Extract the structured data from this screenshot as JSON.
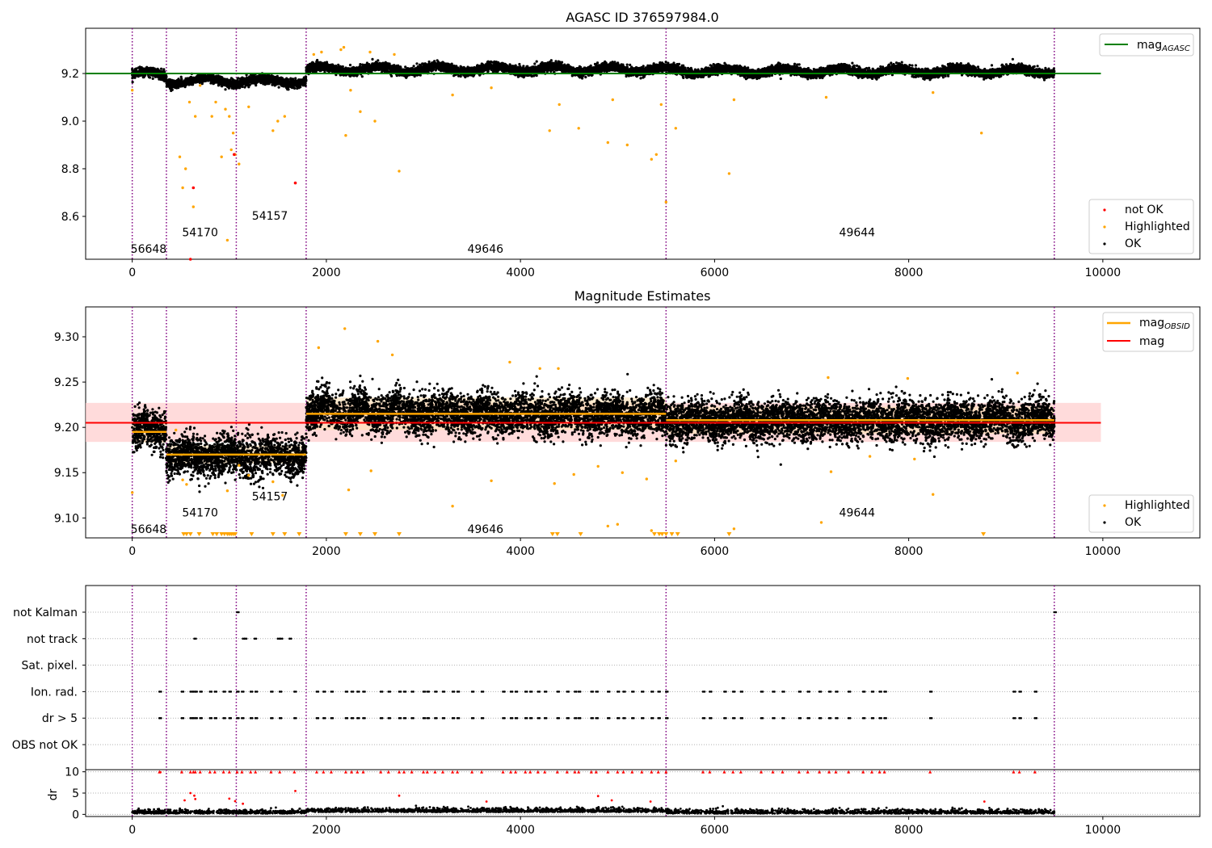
{
  "figure": {
    "title_top": "AGASC ID 376597984.0",
    "title_middle": "Magnitude Estimates"
  },
  "colors": {
    "ok": "#000000",
    "highlighted": "#ffa500",
    "not_ok": "#ff0000",
    "agasc_line": "#008000",
    "mag_line": "#ff0000",
    "obsid_line": "#ffa500",
    "obs_boundary": "#800080",
    "band_mag": "#ffcccc",
    "band_obsid": "#ffe0b0"
  },
  "legends": {
    "top_line": {
      "text": "mag",
      "sub": "AGASC"
    },
    "top_points": [
      "not OK",
      "Highlighted",
      "OK"
    ],
    "middle_lines": [
      {
        "text": "mag",
        "sub": "OBSID"
      },
      {
        "text": "mag",
        "sub": ""
      }
    ],
    "middle_points": [
      "Highlighted",
      "OK"
    ]
  },
  "chart_data": [
    {
      "type": "scatter",
      "title": "AGASC ID 376597984.0",
      "xlim": [
        -480,
        11000
      ],
      "ylim": [
        8.42,
        9.39
      ],
      "xticks": [
        0,
        2000,
        4000,
        6000,
        8000,
        10000
      ],
      "yticks": [
        8.6,
        8.8,
        9.0,
        9.2
      ],
      "agasc_mag": 9.2,
      "agasc_line_x": [
        -480,
        9980
      ],
      "legend": [
        "mag_AGASC",
        "not OK",
        "Highlighted",
        "OK"
      ],
      "observation_boundaries": [
        0,
        352,
        1072,
        1792,
        5500,
        9500
      ],
      "obsids": [
        {
          "label": "56648",
          "x": 0,
          "y": 8.46
        },
        {
          "label": "54170",
          "x": 530,
          "y": 8.53
        },
        {
          "label": "54157",
          "x": 1250,
          "y": 8.6
        },
        {
          "label": "49646",
          "x": 3470,
          "y": 8.46
        },
        {
          "label": "49644",
          "x": 7300,
          "y": 8.53
        }
      ],
      "segments": [
        {
          "x": [
            0,
            352
          ],
          "mean": 9.195,
          "std": 0.012
        },
        {
          "x": [
            352,
            1792
          ],
          "mean": 9.17,
          "std": 0.01
        },
        {
          "x": [
            1792,
            5500
          ],
          "mean": 9.215,
          "std": 0.018
        },
        {
          "x": [
            5500,
            9500
          ],
          "mean": 9.208,
          "std": 0.015
        }
      ],
      "highlighted_points": [
        [
          0,
          9.13
        ],
        [
          490,
          8.85
        ],
        [
          520,
          8.72
        ],
        [
          550,
          8.8
        ],
        [
          590,
          9.08
        ],
        [
          630,
          8.64
        ],
        [
          650,
          9.02
        ],
        [
          700,
          9.15
        ],
        [
          820,
          9.02
        ],
        [
          860,
          9.08
        ],
        [
          920,
          8.85
        ],
        [
          960,
          9.05
        ],
        [
          980,
          8.5
        ],
        [
          1000,
          9.02
        ],
        [
          1020,
          8.88
        ],
        [
          1040,
          8.95
        ],
        [
          1060,
          8.86
        ],
        [
          1100,
          8.82
        ],
        [
          1200,
          9.06
        ],
        [
          1450,
          8.96
        ],
        [
          1500,
          9.0
        ],
        [
          1570,
          9.02
        ],
        [
          2200,
          8.94
        ],
        [
          2250,
          9.13
        ],
        [
          2350,
          9.04
        ],
        [
          2500,
          9.0
        ],
        [
          2750,
          8.79
        ],
        [
          3300,
          9.11
        ],
        [
          3700,
          9.14
        ],
        [
          4300,
          8.96
        ],
        [
          4400,
          9.07
        ],
        [
          4600,
          8.97
        ],
        [
          4900,
          8.91
        ],
        [
          4950,
          9.09
        ],
        [
          5100,
          8.9
        ],
        [
          5350,
          8.84
        ],
        [
          5400,
          8.86
        ],
        [
          5450,
          9.07
        ],
        [
          5500,
          8.66
        ],
        [
          5600,
          8.97
        ],
        [
          6150,
          8.78
        ],
        [
          6200,
          9.09
        ],
        [
          7150,
          9.1
        ],
        [
          8250,
          9.12
        ],
        [
          8750,
          8.95
        ],
        [
          1870,
          9.28
        ],
        [
          1950,
          9.29
        ],
        [
          2150,
          9.3
        ],
        [
          2180,
          9.31
        ],
        [
          2450,
          9.29
        ],
        [
          2700,
          9.28
        ]
      ],
      "not_ok_points": [
        [
          630,
          8.72
        ],
        [
          1050,
          8.86
        ],
        [
          1680,
          8.74
        ],
        [
          600,
          8.42
        ]
      ],
      "ok_points": [
        [
          0,
          9.2
        ],
        [
          200,
          9.21
        ],
        [
          400,
          9.17
        ],
        [
          1000,
          9.17
        ],
        [
          1790,
          9.17
        ],
        [
          2000,
          9.22
        ],
        [
          4000,
          9.21
        ],
        [
          6000,
          9.2
        ],
        [
          9500,
          9.21
        ]
      ]
    },
    {
      "type": "scatter",
      "title": "Magnitude Estimates",
      "xlim": [
        -480,
        11000
      ],
      "ylim": [
        9.078,
        9.333
      ],
      "xticks": [
        0,
        2000,
        4000,
        6000,
        8000,
        10000
      ],
      "yticks": [
        9.1,
        9.15,
        9.2,
        9.25,
        9.3
      ],
      "mag": 9.205,
      "mag_band": [
        9.184,
        9.227
      ],
      "mag_line_x": [
        -480,
        9980
      ],
      "legend": [
        "mag_OBSID",
        "mag",
        "Highlighted",
        "OK"
      ],
      "obsid_mags": [
        {
          "x": [
            0,
            352
          ],
          "mag": 9.195
        },
        {
          "x": [
            352,
            1792
          ],
          "mag": 9.17
        },
        {
          "x": [
            1792,
            5500
          ],
          "mag": 9.215
        },
        {
          "x": [
            5500,
            9500
          ],
          "mag": 9.208
        }
      ],
      "obsids": [
        {
          "label": "56648",
          "x": 0,
          "y": 9.087
        },
        {
          "label": "54170",
          "x": 530,
          "y": 9.105
        },
        {
          "label": "54157",
          "x": 1250,
          "y": 9.123
        },
        {
          "label": "49646",
          "x": 3470,
          "y": 9.087
        },
        {
          "label": "49644",
          "x": 7300,
          "y": 9.105
        }
      ],
      "highlighted_points": [
        [
          0,
          9.128
        ],
        [
          450,
          9.197
        ],
        [
          520,
          9.142
        ],
        [
          560,
          9.137
        ],
        [
          980,
          9.13
        ],
        [
          1100,
          9.158
        ],
        [
          1200,
          9.147
        ],
        [
          1450,
          9.14
        ],
        [
          1550,
          9.125
        ],
        [
          2230,
          9.131
        ],
        [
          2460,
          9.152
        ],
        [
          3300,
          9.113
        ],
        [
          3700,
          9.141
        ],
        [
          4350,
          9.138
        ],
        [
          4550,
          9.148
        ],
        [
          4800,
          9.157
        ],
        [
          5050,
          9.15
        ],
        [
          5300,
          9.143
        ],
        [
          5600,
          9.163
        ],
        [
          7100,
          9.095
        ],
        [
          7200,
          9.151
        ],
        [
          7600,
          9.168
        ],
        [
          8060,
          9.165
        ],
        [
          8250,
          9.126
        ],
        [
          4900,
          9.091
        ],
        [
          5000,
          9.093
        ],
        [
          5350,
          9.086
        ],
        [
          6200,
          9.088
        ],
        [
          1920,
          9.288
        ],
        [
          2190,
          9.309
        ],
        [
          2530,
          9.295
        ],
        [
          2680,
          9.28
        ],
        [
          3890,
          9.272
        ],
        [
          4200,
          9.265
        ],
        [
          4390,
          9.265
        ],
        [
          7170,
          9.255
        ],
        [
          7990,
          9.254
        ],
        [
          9120,
          9.26
        ]
      ],
      "below_range_x": [
        530,
        560,
        600,
        690,
        830,
        870,
        920,
        950,
        980,
        1000,
        1020,
        1040,
        1060,
        1230,
        1450,
        1570,
        1720,
        2200,
        2350,
        2500,
        2750,
        4330,
        4380,
        4620,
        5380,
        5430,
        5460,
        5500,
        5560,
        5620,
        6150,
        8770
      ],
      "ok_points": [
        [
          0,
          9.2
        ],
        [
          200,
          9.2
        ],
        [
          1000,
          9.17
        ],
        [
          2000,
          9.22
        ],
        [
          4000,
          9.21
        ],
        [
          6000,
          9.21
        ],
        [
          9500,
          9.21
        ]
      ]
    },
    {
      "type": "scatter",
      "xlim": [
        -480,
        11000
      ],
      "xticks": [
        0,
        2000,
        4000,
        6000,
        8000,
        10000
      ],
      "categories": [
        "not Kalman",
        "not track",
        "Sat. pixel.",
        "Ion. rad.",
        "dr > 5",
        "OBS not OK"
      ],
      "observation_boundaries": [
        0,
        352,
        1072,
        1792,
        5500,
        9500
      ],
      "flag_points": {
        "not Kalman": [
          1080,
          9500
        ],
        "not track": [
          640,
          1140,
          1160,
          1260,
          1500,
          1530,
          1620
        ],
        "Sat. pixel.": [],
        "Ion. rad.": [
          280,
          510,
          600,
          630,
          650,
          700,
          800,
          850,
          940,
          1000,
          1080,
          1130,
          1220,
          1270,
          1430,
          1520,
          1670,
          1900,
          1970,
          2050,
          2200,
          2260,
          2320,
          2380,
          2560,
          2640,
          2750,
          2800,
          2880,
          3000,
          3040,
          3120,
          3200,
          3300,
          3350,
          3500,
          3600,
          3820,
          3900,
          3950,
          4050,
          4100,
          4180,
          4250,
          4380,
          4480,
          4560,
          4600,
          4730,
          4780,
          4900,
          5000,
          5060,
          5150,
          5250,
          5350,
          5420,
          5500,
          5880,
          5950,
          6100,
          6190,
          6270,
          6480,
          6600,
          6700,
          6870,
          6960,
          7080,
          7180,
          7250,
          7380,
          7530,
          7620,
          7700,
          7750,
          8220,
          9080,
          9140,
          9300
        ]
      },
      "dr_ylim": [
        -0.5,
        10.5
      ],
      "dr_yticks": [
        0,
        5,
        10
      ],
      "dr_ylabel": "dr",
      "dr_high_points": [
        [
          290,
          9.9
        ],
        [
          600,
          5.0
        ],
        [
          640,
          4.4
        ],
        [
          650,
          3.6
        ],
        [
          540,
          3.3
        ],
        [
          1000,
          3.7
        ],
        [
          1060,
          3.1
        ],
        [
          1140,
          2.5
        ],
        [
          1680,
          5.5
        ],
        [
          2750,
          4.4
        ],
        [
          3650,
          3.0
        ],
        [
          4800,
          4.3
        ],
        [
          4940,
          3.3
        ],
        [
          5340,
          3.0
        ],
        [
          8780,
          3.0
        ]
      ],
      "dr_ok_points": [
        [
          0,
          0.5
        ],
        [
          1000,
          0.8
        ],
        [
          2000,
          1.2
        ],
        [
          4000,
          1.0
        ],
        [
          6000,
          0.6
        ],
        [
          9500,
          0.5
        ]
      ]
    }
  ]
}
